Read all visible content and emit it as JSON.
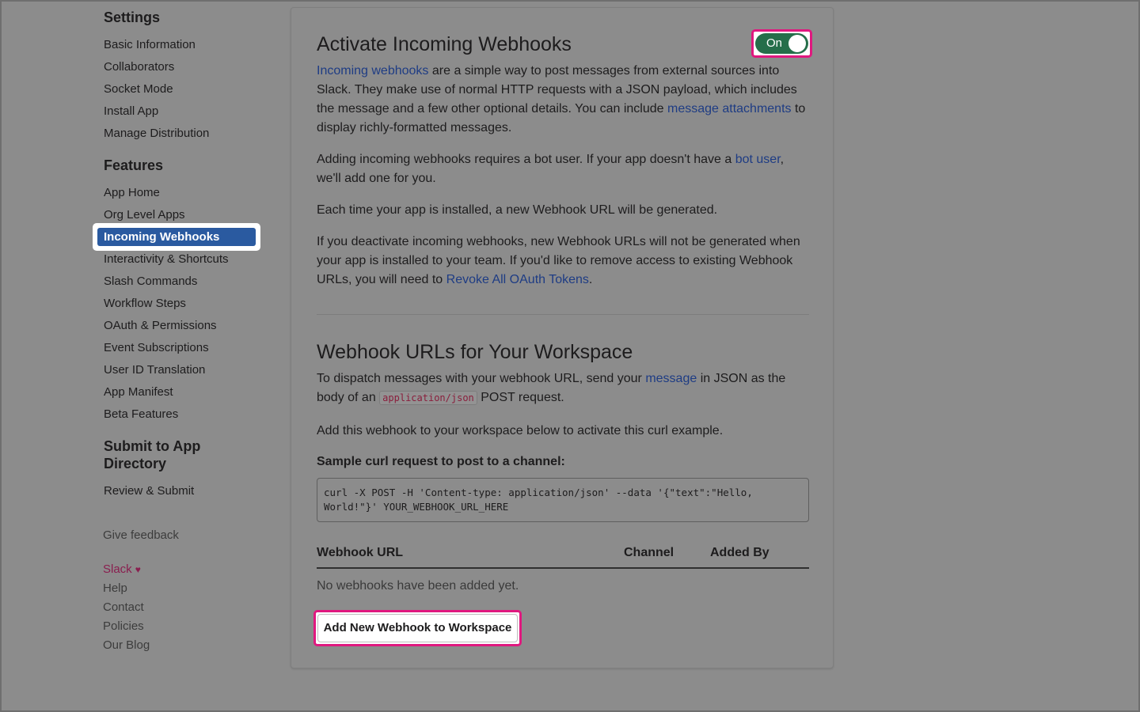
{
  "sidebar": {
    "settings_heading": "Settings",
    "settings_items": [
      "Basic Information",
      "Collaborators",
      "Socket Mode",
      "Install App",
      "Manage Distribution"
    ],
    "features_heading": "Features",
    "features_items": [
      "App Home",
      "Org Level Apps",
      "Incoming Webhooks",
      "Interactivity & Shortcuts",
      "Slash Commands",
      "Workflow Steps",
      "OAuth & Permissions",
      "Event Subscriptions",
      "User ID Translation",
      "App Manifest",
      "Beta Features"
    ],
    "active_item": "Incoming Webhooks",
    "submit_heading_line1": "Submit to App",
    "submit_heading_line2": "Directory",
    "submit_items": [
      "Review & Submit"
    ],
    "give_feedback": "Give feedback",
    "footer_links": [
      "Slack",
      "Help",
      "Contact",
      "Policies",
      "Our Blog"
    ],
    "heart_icon": "♥"
  },
  "main": {
    "activate": {
      "title": "Activate Incoming Webhooks",
      "toggle_label": "On",
      "toggle_color": "#256e4a",
      "p1_link1": "Incoming webhooks",
      "p1_text1": " are a simple way to post messages from external sources into Slack. They make use of normal HTTP requests with a JSON payload, which includes the message and a few other optional details. You can include ",
      "p1_link2": "message attachments",
      "p1_text2": " to display richly-formatted messages.",
      "p2_text1": "Adding incoming webhooks requires a bot user. If your app doesn't have a ",
      "p2_link": "bot user",
      "p2_text2": ", we'll add one for you.",
      "p3": "Each time your app is installed, a new Webhook URL will be generated.",
      "p4_text1": "If you deactivate incoming webhooks, new Webhook URLs will not be generated when your app is installed to your team. If you'd like to remove access to existing Webhook URLs, you will need to ",
      "p4_link": "Revoke All OAuth Tokens",
      "p4_text2": "."
    },
    "webhooks": {
      "title": "Webhook URLs for Your Workspace",
      "p1_text1": "To dispatch messages with your webhook URL, send your ",
      "p1_link": "message",
      "p1_text2": " in JSON as the body of an ",
      "p1_code": "application/json",
      "p1_text3": " POST request.",
      "p2": "Add this webhook to your workspace below to activate this curl example.",
      "sample_heading": "Sample curl request to post to a channel:",
      "curl_line1": "curl -X POST -H 'Content-type: application/json' --data '{\"text\":\"Hello,",
      "curl_line2": "World!\"}' YOUR_WEBHOOK_URL_HERE",
      "table_headers": [
        "Webhook URL",
        "Channel",
        "Added By"
      ],
      "empty_text": "No webhooks have been added yet.",
      "add_button": "Add New Webhook to Workspace"
    }
  },
  "colors": {
    "highlight_border": "#e0187f",
    "active_nav": "#2a5aa0",
    "link": "#1e3c84"
  }
}
